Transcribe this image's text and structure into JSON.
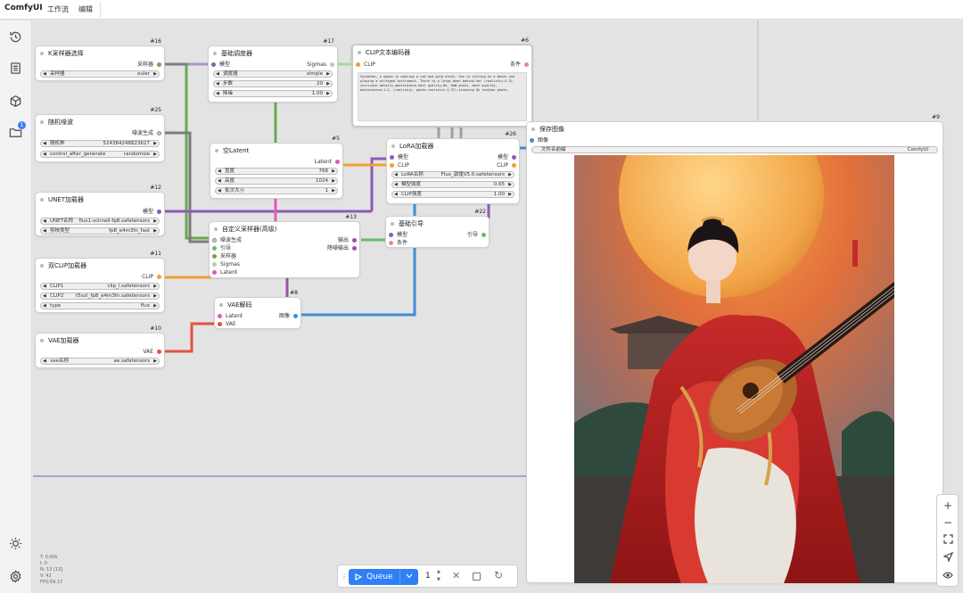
{
  "app": {
    "name": "ComfyUI"
  },
  "menu": {
    "workflow": "工作流",
    "edit": "编辑"
  },
  "sidebar": {
    "queue_badge": "1",
    "icons": [
      "history-icon",
      "node-library-icon",
      "model-library-icon",
      "workflows-icon",
      "theme-icon",
      "settings-icon"
    ]
  },
  "nodes": {
    "ksampler_select": {
      "id": "#16",
      "title": "K采样器选择",
      "out": "采样器",
      "w_label": "采样器",
      "w_value": "euler"
    },
    "random_noise": {
      "id": "#25",
      "title": "随机噪波",
      "out": "噪波生成",
      "w1_label": "随机种",
      "w1_value": "524384248823627",
      "w2_label": "control_after_generate",
      "w2_value": "randomize"
    },
    "unet_loader": {
      "id": "#12",
      "title": "UNET加载器",
      "out": "模型",
      "w1_label": "UNET名称",
      "w1_value": "flux1-schnell-fp8.safetensors",
      "w2_label": "剪枝类型",
      "w2_value": "fp8_e4m3fn_fast"
    },
    "dual_clip": {
      "id": "#11",
      "title": "双CLIP加载器",
      "out": "CLIP",
      "w1_label": "CLIP1",
      "w1_value": "clip_l.safetensors",
      "w2_label": "CLIP2",
      "w2_value": "t5xxl_fp8_e4m3fn.safetensors",
      "w3_label": "type",
      "w3_value": "flux"
    },
    "vae_loader": {
      "id": "#10",
      "title": "VAE加载器",
      "out": "VAE",
      "w_label": "vae名称",
      "w_value": "ae.safetensors"
    },
    "basic_scheduler": {
      "id": "#17",
      "title": "基础调度器",
      "in": "模型",
      "out": "Sigmas",
      "w1_label": "调度器",
      "w1_value": "simple",
      "w2_label": "步数",
      "w2_value": "20",
      "w3_label": "降噪",
      "w3_value": "1.00"
    },
    "empty_latent": {
      "id": "#5",
      "title": "空Latent",
      "out": "Latent",
      "w1_label": "宽度",
      "w1_value": "768",
      "w2_label": "高度",
      "w2_value": "1024",
      "w3_label": "批次大小",
      "w3_value": "1"
    },
    "custom_sampler": {
      "id": "#13",
      "title": "自定义采样器(高级)",
      "in1": "噪波生成",
      "in2": "引导",
      "in3": "采样器",
      "in4": "Sigmas",
      "in5": "Latent",
      "out1": "输出",
      "out2": "降噪输出"
    },
    "vae_decode": {
      "id": "#8",
      "title": "VAE解码",
      "in1": "Latent",
      "in2": "VAE",
      "out": "图像"
    },
    "clip_encode": {
      "id": "#6",
      "title": "CLIP文本编码器",
      "in": "CLIP",
      "out": "条件",
      "text": "Sunbathe, a woman is wearing a red and gold dress. She is sitting on a bench and playing a stringed instrument. There is a large moon behind her (realistic:1.3), intricate details,masterpiece,best quality,8k, RAW photo, best quality, masterpiece:1.2, (realistic, photo-realistic:1.37),stunning 8k fashion photo,"
    },
    "lora_loader": {
      "id": "#26",
      "title": "LoRA加载器",
      "in1": "模型",
      "in2": "CLIP",
      "out1": "模型",
      "out2": "CLIP",
      "w1_label": "LoRA名称",
      "w1_value": "Flux_敦煌V5.0.safetensors",
      "w2_label": "模型强度",
      "w2_value": "0.65",
      "w3_label": "CLIP强度",
      "w3_value": "1.00"
    },
    "basic_guider": {
      "id": "#22",
      "title": "基础引导",
      "in1": "模型",
      "in2": "条件",
      "out": "引导"
    },
    "save_image": {
      "id": "#9",
      "title": "保存图像",
      "in": "图像",
      "w_label": "文件名前缀",
      "w_value": "ComfyUI"
    }
  },
  "status": {
    "t": "T: 0.00s",
    "i": "I: 0",
    "n": "N: 13 [13]",
    "v": "V: 42",
    "fps": "FPS:59.17"
  },
  "queue": {
    "label": "Queue",
    "count": "1"
  },
  "colors": {
    "model": "#8c5bb6",
    "clip": "#f0a030",
    "vae": "#e0533f",
    "latent": "#e05cb0",
    "image": "#3d8fd6",
    "conditioning": "#e38a8a",
    "sampler": "#6aa84f",
    "sigmas": "#a8d8a0",
    "noise": "#c9c9c9",
    "guider": "#66bb6a",
    "accent": "#2f7ff5"
  }
}
